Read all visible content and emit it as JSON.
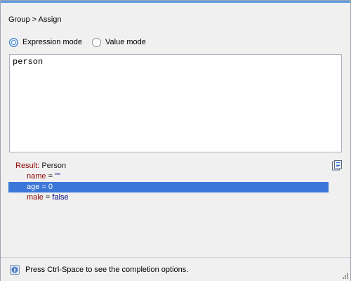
{
  "breadcrumb": "Group > Assign",
  "modes": {
    "expression_label": "Expression mode",
    "value_label": "Value mode",
    "selected": "expression"
  },
  "editor": {
    "value": "person"
  },
  "result": {
    "label": "Result:",
    "type": "Person",
    "fields": [
      {
        "name": "name",
        "eq": " = ",
        "value": "\"\""
      },
      {
        "name": "age",
        "eq": " = ",
        "value": "0",
        "selected": true
      },
      {
        "name": "male",
        "eq": " = ",
        "value": "false"
      }
    ]
  },
  "status": {
    "text": "Press Ctrl-Space to see the completion options."
  },
  "colors": {
    "accent": "#3b77d8",
    "field_name": "#8b0000",
    "value": "#000080"
  }
}
